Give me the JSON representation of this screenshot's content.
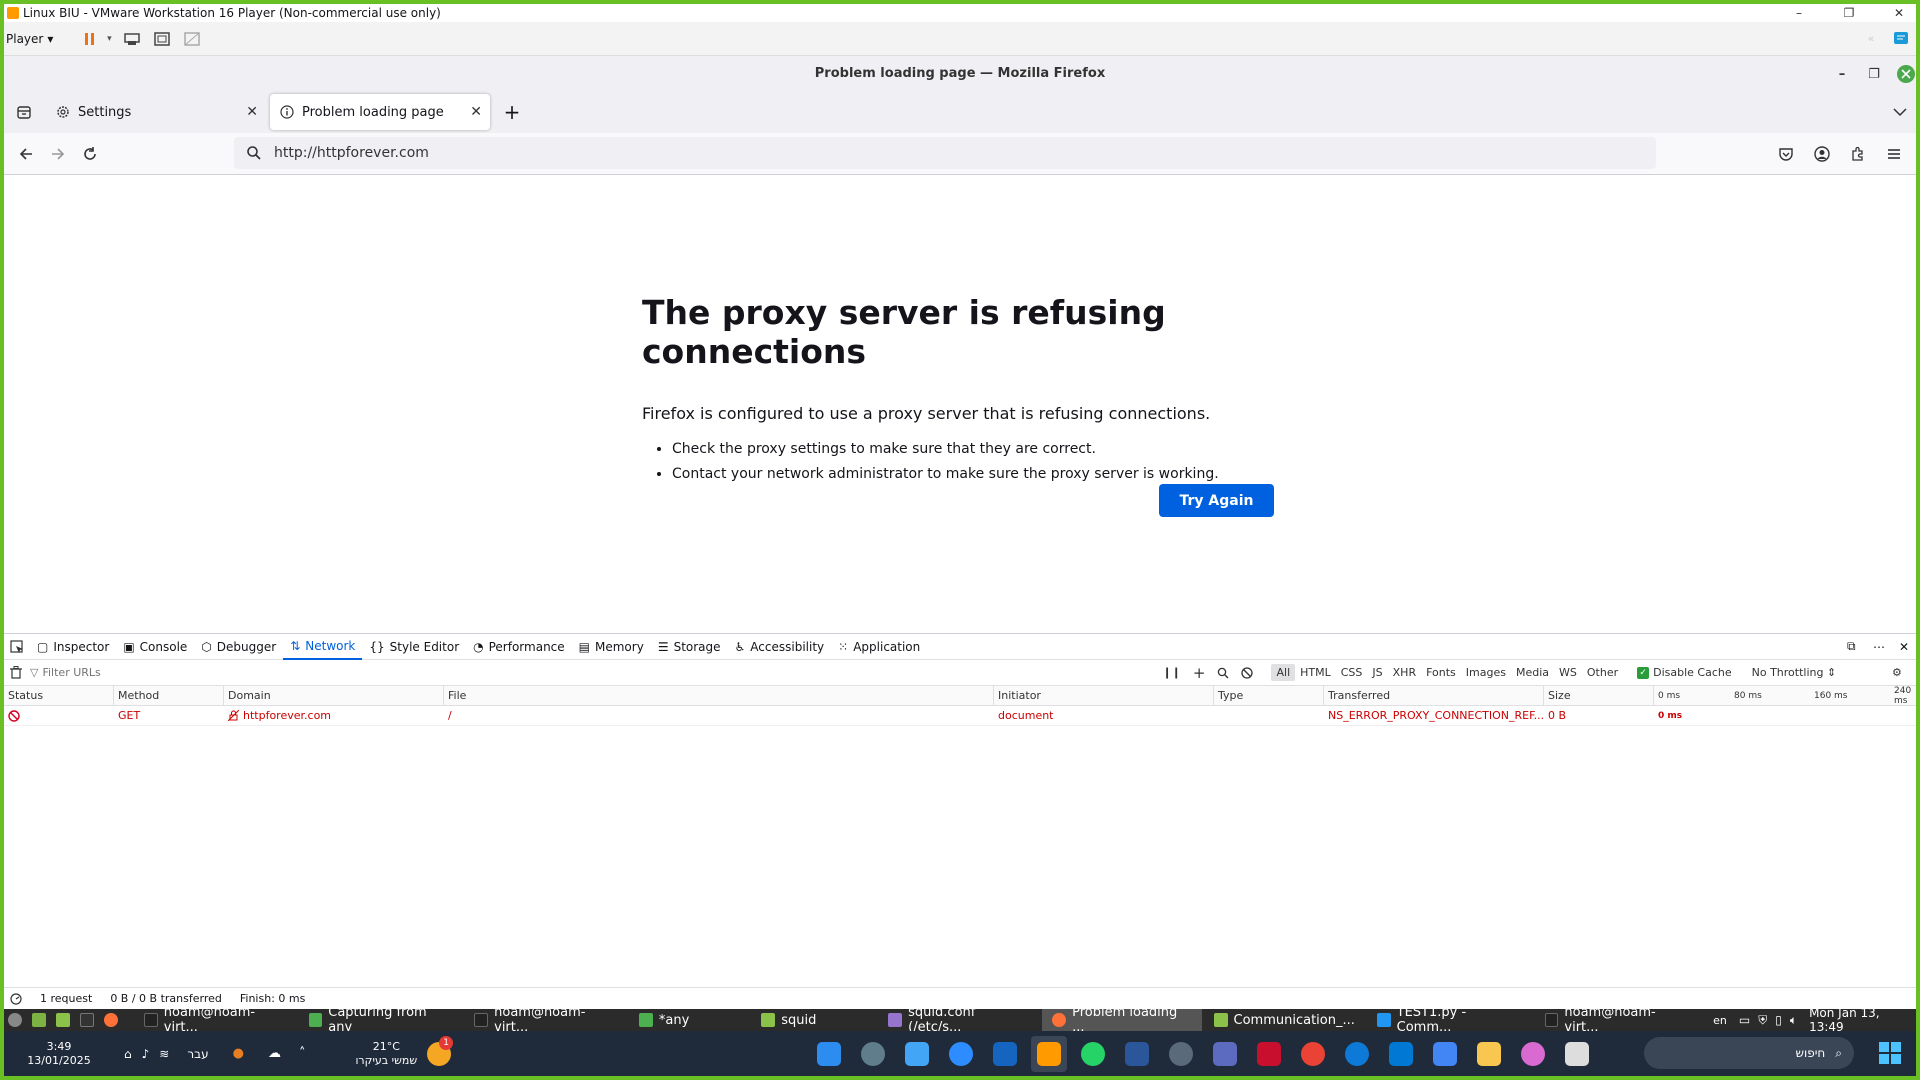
{
  "vm_window": {
    "title": "Linux BIU - VMware Workstation 16 Player (Non-commercial use only)",
    "player_label": "Player"
  },
  "firefox": {
    "window_title": "Problem loading page — Mozilla Firefox",
    "tabs": [
      {
        "label": "Settings",
        "icon": "gear-icon",
        "active": false
      },
      {
        "label": "Problem loading page",
        "icon": "info-icon",
        "active": true
      }
    ],
    "url": "http://httpforever.com"
  },
  "error_page": {
    "heading": "The proxy server is refusing connections",
    "description": "Firefox is configured to use a proxy server that is refusing connections.",
    "bullets": [
      "Check the proxy settings to make sure that they are correct.",
      "Contact your network administrator to make sure the proxy server is working."
    ],
    "try_again_label": "Try Again",
    "accent_color": "#0061e0"
  },
  "devtools": {
    "tabs": [
      "Inspector",
      "Console",
      "Debugger",
      "Network",
      "Style Editor",
      "Performance",
      "Memory",
      "Storage",
      "Accessibility",
      "Application"
    ],
    "active_tab": "Network",
    "filter_placeholder": "Filter URLs",
    "type_filters": [
      "All",
      "HTML",
      "CSS",
      "JS",
      "XHR",
      "Fonts",
      "Images",
      "Media",
      "WS",
      "Other"
    ],
    "disable_cache_label": "Disable Cache",
    "throttling_label": "No Throttling ⇕",
    "columns": [
      "Status",
      "Method",
      "Domain",
      "File",
      "Initiator",
      "Type",
      "Transferred",
      "Size"
    ],
    "timeline_ticks": [
      "0 ms",
      "80 ms",
      "160 ms",
      "240 ms"
    ],
    "rows": [
      {
        "method": "GET",
        "domain": "httpforever.com",
        "file": "/",
        "initiator": "document",
        "type": "",
        "transferred": "NS_ERROR_PROXY_CONNECTION_REF...",
        "size": "0 B",
        "timing": "0 ms"
      }
    ],
    "status_bar": {
      "requests": "1 request",
      "transferred": "0 B / 0 B transferred",
      "finish": "Finish: 0 ms"
    }
  },
  "vm_taskbar": {
    "items": [
      {
        "label": "noam@noam-virt...",
        "active": false
      },
      {
        "label": "Capturing from any",
        "active": false
      },
      {
        "label": "noam@noam-virt...",
        "active": false
      },
      {
        "label": "*any",
        "active": false
      },
      {
        "label": "squid",
        "active": false
      },
      {
        "label": "squid.conf (/etc/s...",
        "active": false
      },
      {
        "label": "Problem loading ...",
        "active": true
      },
      {
        "label": "Communication_...",
        "active": false
      },
      {
        "label": "TEST1.py - Comm...",
        "active": false
      },
      {
        "label": "noam@noam-virt...",
        "active": false
      }
    ],
    "lang": "en",
    "datetime": "Mon Jan 13, 13:49"
  },
  "windows_taskbar": {
    "time": "3:49",
    "date": "13/01/2025",
    "lang": "עבר",
    "weather_temp": "21°C",
    "weather_desc": "שמשי בעיקרו",
    "notification_count": "1",
    "search_placeholder": "חיפוש"
  }
}
